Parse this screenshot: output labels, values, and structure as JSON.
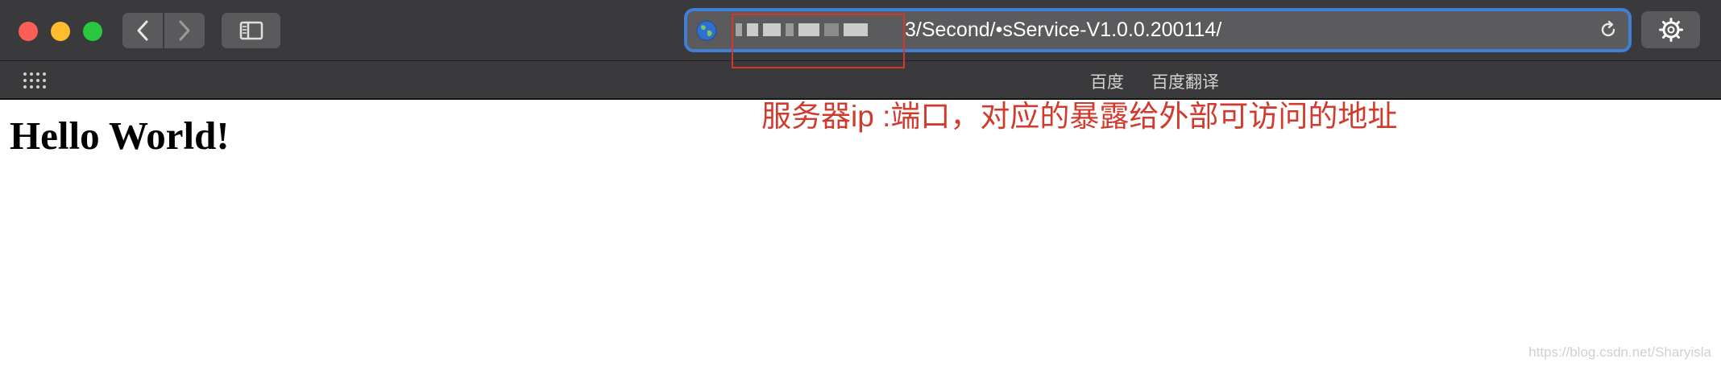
{
  "window": {
    "controls": [
      "close",
      "minimize",
      "zoom"
    ],
    "icons": {
      "back": "chevron-left-icon",
      "forward": "chevron-right-icon",
      "sidebar": "sidebar-icon",
      "globe": "globe-icon",
      "reload": "reload-icon",
      "settings": "gear-icon",
      "favorites_grid": "grid-icon"
    }
  },
  "address_bar": {
    "url_visible": "3/Second/•sService-V1.0.0.200114/",
    "accent_color": "#3f7fd6"
  },
  "favorites": [
    "百度",
    "百度翻译"
  ],
  "page": {
    "heading": "Hello World!"
  },
  "annotation": {
    "text": "服务器ip :端口，对应的暴露给外部可访问的地址",
    "color": "#d13a2c"
  },
  "watermark": "https://blog.csdn.net/Sharyisla"
}
